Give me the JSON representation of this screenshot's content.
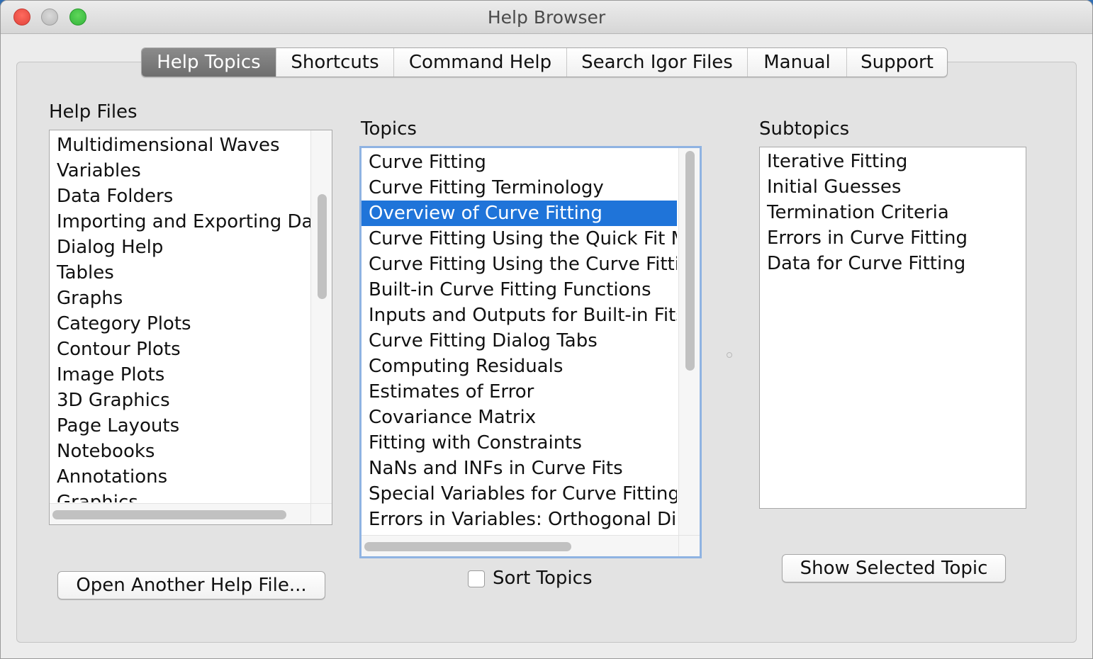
{
  "window": {
    "title": "Help Browser"
  },
  "tabs": [
    {
      "label": "Help Topics",
      "active": true
    },
    {
      "label": "Shortcuts",
      "active": false
    },
    {
      "label": "Command Help",
      "active": false
    },
    {
      "label": "Search Igor Files",
      "active": false
    },
    {
      "label": "Manual",
      "active": false
    },
    {
      "label": "Support",
      "active": false
    }
  ],
  "help_files": {
    "label": "Help Files",
    "items": [
      "Multidimensional Waves",
      "Variables",
      "Data Folders",
      "Importing and Exporting Dat",
      "Dialog Help",
      "Tables",
      "Graphs",
      "Category Plots",
      "Contour Plots",
      "Image Plots",
      "3D Graphics",
      "Page Layouts",
      "Notebooks",
      "Annotations",
      "Graphics"
    ],
    "open_button": "Open Another Help File..."
  },
  "topics": {
    "label": "Topics",
    "items": [
      "Curve Fitting",
      "Curve Fitting Terminology",
      "Overview of Curve Fitting",
      "Curve Fitting Using the Quick Fit M",
      "Curve Fitting Using the Curve Fittir",
      "Built-in Curve Fitting Functions",
      "Inputs and Outputs for Built-in Fits",
      "Curve Fitting Dialog Tabs",
      "Computing Residuals",
      "Estimates of Error",
      "Covariance Matrix",
      "Fitting with Constraints",
      "NaNs and INFs in Curve Fits",
      "Special Variables for Curve Fitting",
      "Errors in Variables: Orthogonal Dis"
    ],
    "selected": "Overview of Curve Fitting",
    "sort_label": "Sort Topics",
    "sort_checked": false
  },
  "subtopics": {
    "label": "Subtopics",
    "items": [
      "Iterative Fitting",
      "Initial Guesses",
      "Termination Criteria",
      "Errors in Curve Fitting",
      "Data for Curve Fitting"
    ],
    "show_button": "Show Selected Topic"
  },
  "colors": {
    "selection": "#1f74d9",
    "active_tab": "#7b7b7b"
  }
}
